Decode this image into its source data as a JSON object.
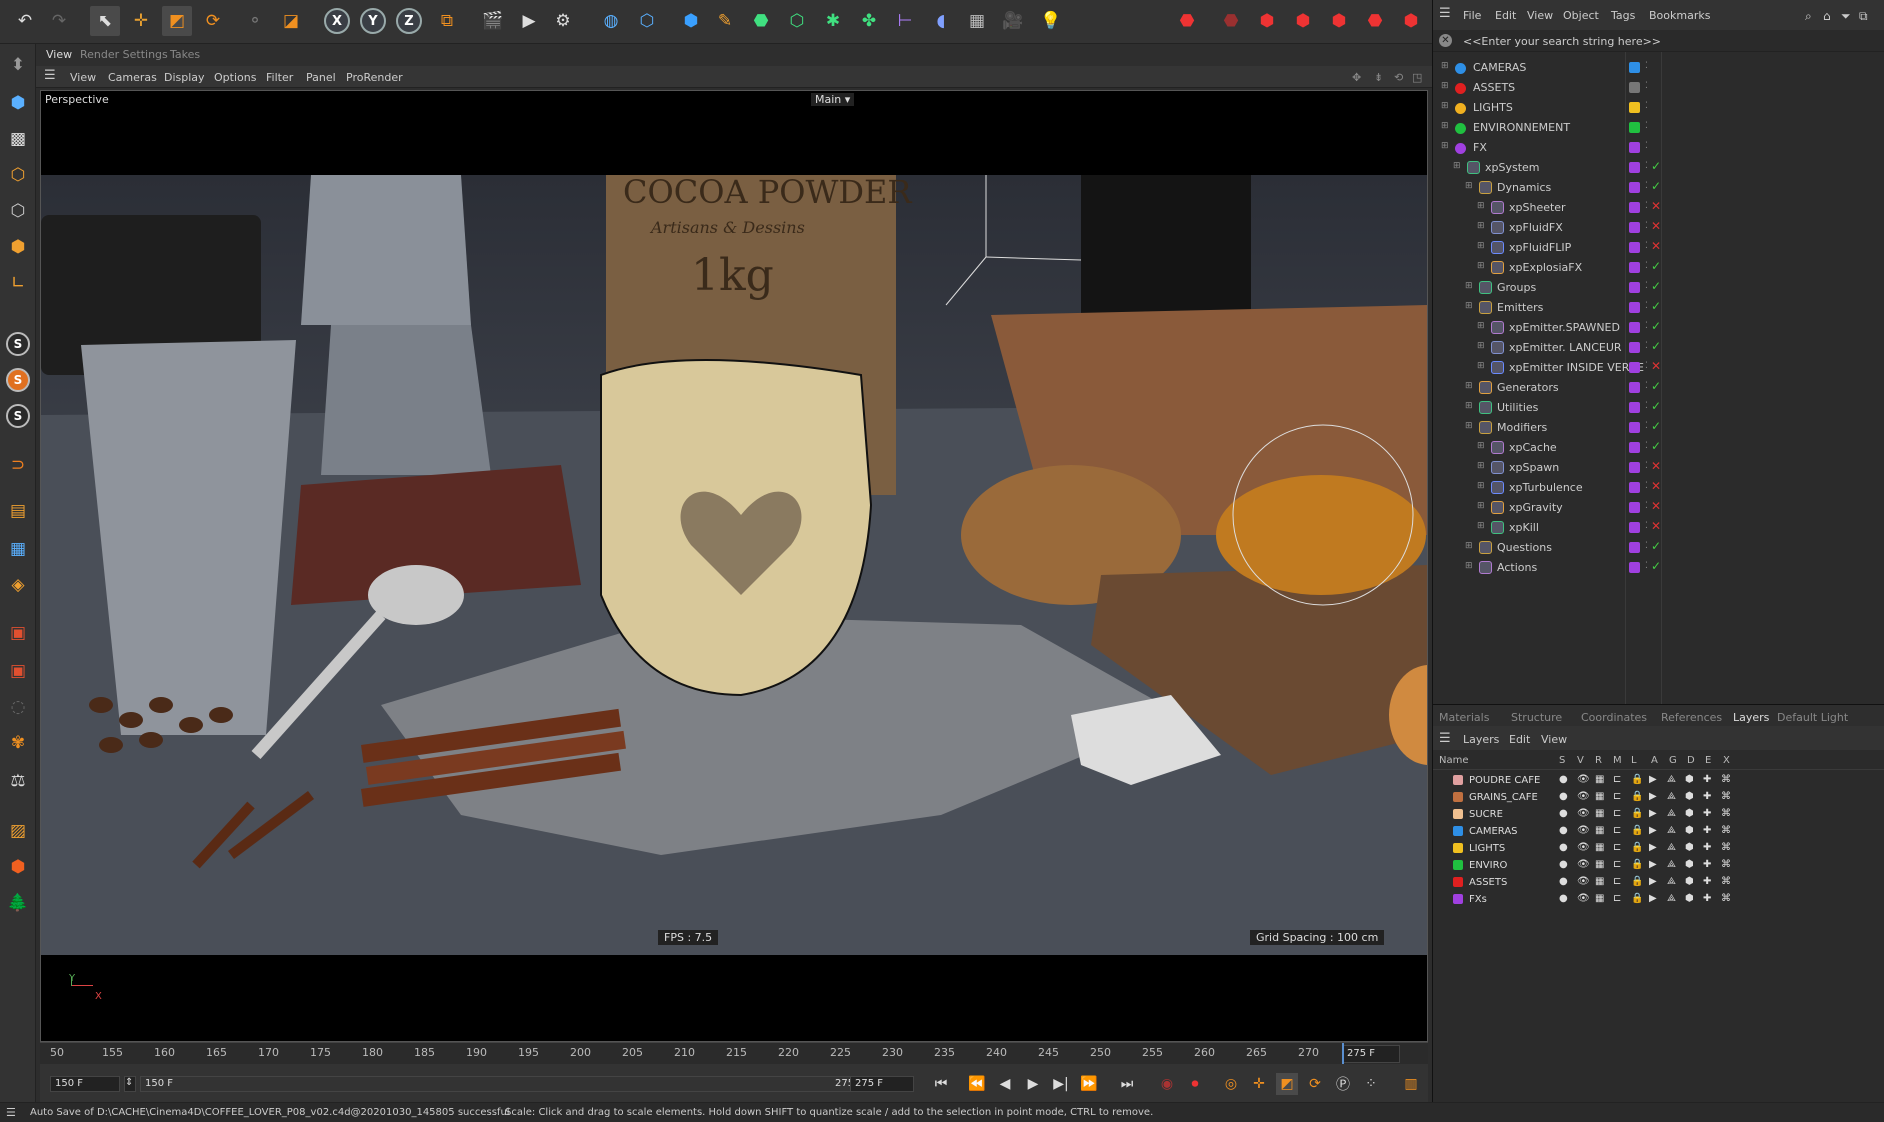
{
  "menus": {
    "main": [
      "File",
      "Edit",
      "View",
      "Object",
      "Tags",
      "Bookmarks"
    ],
    "viewport_tabs": [
      "View",
      "Render Settings",
      "Takes"
    ],
    "viewport_menu": [
      "View",
      "Cameras",
      "Display",
      "Options",
      "Filter",
      "Panel",
      "ProRender"
    ],
    "lower_tabs": [
      "Materials",
      "Structure",
      "Coordinates",
      "References",
      "Layers",
      "Default Light"
    ],
    "layer_menu": [
      "Layers",
      "Edit",
      "View"
    ]
  },
  "viewport": {
    "label": "Perspective",
    "camera": "Main",
    "fps": "FPS : 7.5",
    "grid_spacing": "Grid Spacing : 100 cm",
    "axis_y": "Y",
    "axis_x": "X",
    "scene_text": [
      "COCOA POWDER",
      "Artisans & Dessins",
      "1kg"
    ]
  },
  "search_placeholder": "<<Enter your search string here>>",
  "objects": [
    {
      "label": "CAMERAS",
      "indent": 0,
      "color": "#2e8fe6",
      "swatch": "#2e8fe6",
      "check": ""
    },
    {
      "label": "ASSETS",
      "indent": 0,
      "color": "#e02020",
      "swatch": "#777",
      "check": ""
    },
    {
      "label": "LIGHTS",
      "indent": 0,
      "color": "#f0b020",
      "swatch": "#f0c020",
      "check": ""
    },
    {
      "label": "ENVIRONNEMENT",
      "indent": 0,
      "color": "#20c040",
      "swatch": "#20c040",
      "check": ""
    },
    {
      "label": "FX",
      "indent": 0,
      "color": "#a040e0",
      "swatch": "#a040e0",
      "check": ""
    },
    {
      "label": "xpSystem",
      "indent": 1,
      "color": "",
      "swatch": "#a040e0",
      "check": "✓"
    },
    {
      "label": "Dynamics",
      "indent": 2,
      "color": "",
      "swatch": "#a040e0",
      "check": "✓"
    },
    {
      "label": "xpSheeter",
      "indent": 3,
      "color": "",
      "swatch": "#a040e0",
      "check": "✕"
    },
    {
      "label": "xpFluidFX",
      "indent": 3,
      "color": "",
      "swatch": "#a040e0",
      "check": "✕"
    },
    {
      "label": "xpFluidFLIP",
      "indent": 3,
      "color": "",
      "swatch": "#a040e0",
      "check": "✕"
    },
    {
      "label": "xpExplosiaFX",
      "indent": 3,
      "color": "",
      "swatch": "#a040e0",
      "check": "✓"
    },
    {
      "label": "Groups",
      "indent": 2,
      "color": "",
      "swatch": "#a040e0",
      "check": "✓"
    },
    {
      "label": "Emitters",
      "indent": 2,
      "color": "",
      "swatch": "#a040e0",
      "check": "✓"
    },
    {
      "label": "xpEmitter.SPAWNED",
      "indent": 3,
      "color": "",
      "swatch": "#a040e0",
      "check": "✓"
    },
    {
      "label": "xpEmitter. LANCEUR",
      "indent": 3,
      "color": "",
      "swatch": "#a040e0",
      "check": "✓"
    },
    {
      "label": "xpEmitter INSIDE VERRE",
      "indent": 3,
      "color": "",
      "swatch": "#a040e0",
      "check": "✕"
    },
    {
      "label": "Generators",
      "indent": 2,
      "color": "",
      "swatch": "#a040e0",
      "check": "✓"
    },
    {
      "label": "Utilities",
      "indent": 2,
      "color": "",
      "swatch": "#a040e0",
      "check": "✓"
    },
    {
      "label": "Modifiers",
      "indent": 2,
      "color": "",
      "swatch": "#a040e0",
      "check": "✓"
    },
    {
      "label": "xpCache",
      "indent": 3,
      "color": "",
      "swatch": "#a040e0",
      "check": "✓"
    },
    {
      "label": "xpSpawn",
      "indent": 3,
      "color": "",
      "swatch": "#a040e0",
      "check": "✕"
    },
    {
      "label": "xpTurbulence",
      "indent": 3,
      "color": "",
      "swatch": "#a040e0",
      "check": "✕"
    },
    {
      "label": "xpGravity",
      "indent": 3,
      "color": "",
      "swatch": "#a040e0",
      "check": "✕"
    },
    {
      "label": "xpKill",
      "indent": 3,
      "color": "",
      "swatch": "#a040e0",
      "check": "✕"
    },
    {
      "label": "Questions",
      "indent": 2,
      "color": "",
      "swatch": "#a040e0",
      "check": "✓"
    },
    {
      "label": "Actions",
      "indent": 2,
      "color": "",
      "swatch": "#a040e0",
      "check": "✓"
    }
  ],
  "layer_headers": [
    "Name",
    "S",
    "V",
    "R",
    "M",
    "L",
    "A",
    "G",
    "D",
    "E",
    "X"
  ],
  "layers": [
    {
      "name": "POUDRE CAFE",
      "color": "#e0a0a0"
    },
    {
      "name": "GRAINS_CAFE",
      "color": "#c07040"
    },
    {
      "name": "SUCRE",
      "color": "#f0c090"
    },
    {
      "name": "CAMERAS",
      "color": "#2e8fe6"
    },
    {
      "name": "LIGHTS",
      "color": "#f0c020"
    },
    {
      "name": "ENVIRO",
      "color": "#20c040"
    },
    {
      "name": "ASSETS",
      "color": "#e02020"
    },
    {
      "name": "FXs",
      "color": "#a040e0"
    }
  ],
  "timeline": {
    "ticks": [
      "50",
      "155",
      "160",
      "165",
      "170",
      "175",
      "180",
      "185",
      "190",
      "195",
      "200",
      "205",
      "210",
      "215",
      "220",
      "225",
      "230",
      "235",
      "240",
      "245",
      "250",
      "255",
      "260",
      "265",
      "270",
      "2"
    ],
    "current_frame_box": "275 F",
    "start_field": "150 F",
    "range_start": "150 F",
    "range_end": "275 F",
    "end_field": "275 F"
  },
  "status": {
    "left": "Auto Save of D:\\CACHE\\Cinema4D\\COFFEE_LOVER_P08_v02.c4d@20201030_145805 successful",
    "right": "Scale: Click and drag to scale elements. Hold down SHIFT to quantize scale / add to the selection in point mode, CTRL to remove."
  }
}
